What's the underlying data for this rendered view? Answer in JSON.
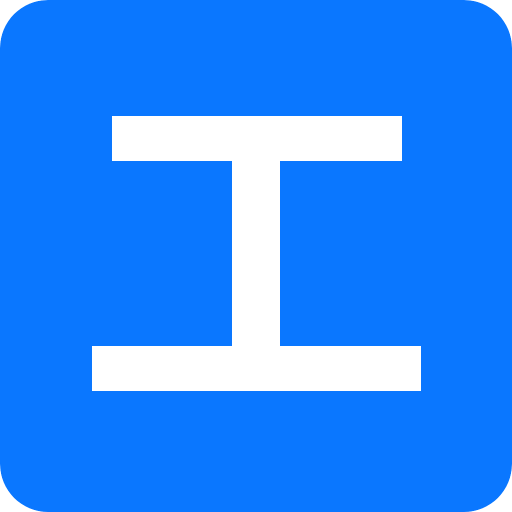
{
  "app_icon": {
    "icon": "text-cursor-icon",
    "background_color": "#0A77FF",
    "glyph_color": "#FFFFFF"
  }
}
